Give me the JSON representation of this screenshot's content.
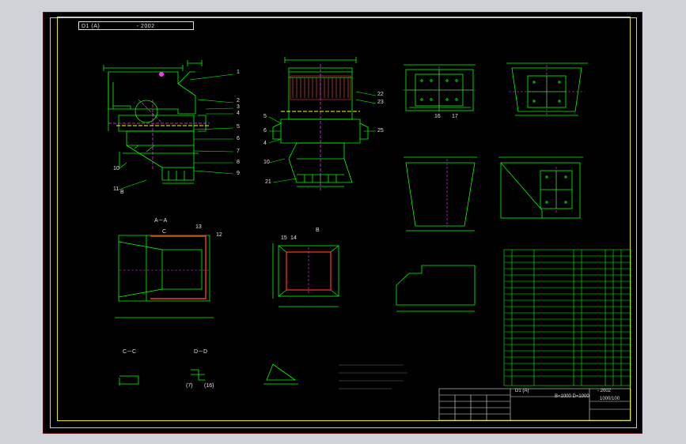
{
  "drawing": {
    "header_tag": "D1 (A)",
    "header_code": "- 2002",
    "views": {
      "section_aa": "A－A",
      "section_cc": "C－C",
      "section_dd": "D－D",
      "view_b": "B",
      "view_b2": "B",
      "view_c": "C"
    },
    "callouts_left": [
      "1",
      "2",
      "3",
      "4",
      "5",
      "6",
      "7",
      "8",
      "9",
      "10",
      "11"
    ],
    "callouts_mid": [
      "5",
      "6",
      "4",
      "10",
      "21",
      "22",
      "23",
      "25"
    ],
    "callouts_plan": [
      "15",
      "16",
      "17"
    ],
    "callouts_section": [
      "12",
      "13",
      "14",
      "15"
    ],
    "detail_marks": [
      "(7)",
      "(16)"
    ],
    "notes_title": "",
    "title_block": {
      "drawing_no": "D1 (A)",
      "code": "- 2002",
      "size": "B=1000 D=1000",
      "scale": "1000/100",
      "weight": ""
    }
  },
  "colors": {
    "background": "#000000",
    "outline": "#00ff00",
    "centerline": "#ff33ff",
    "hidden": "#ffff00",
    "text": "#e0e0e0",
    "frame": "#c8c8c8",
    "border": "#e6e600"
  }
}
